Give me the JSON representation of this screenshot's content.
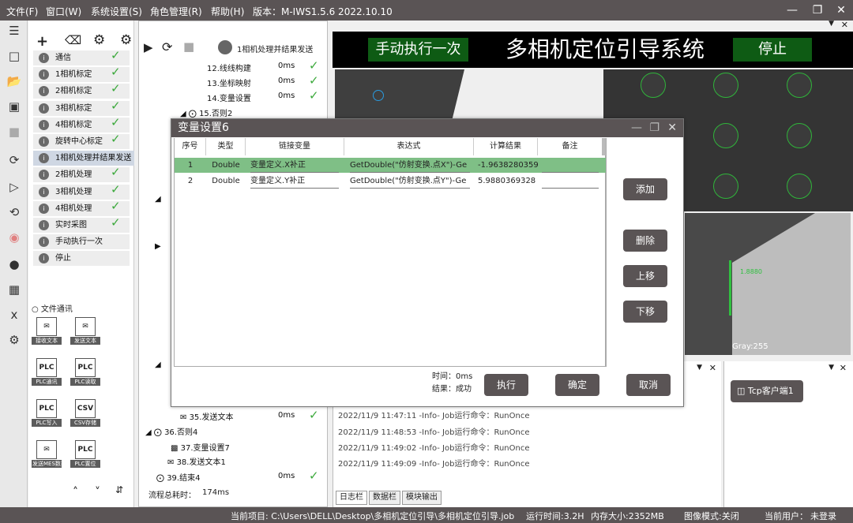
{
  "menu": {
    "file": "文件(F)",
    "window": "窗口(W)",
    "settings": "系统设置(S)",
    "role": "角色管理(R)",
    "help": "帮助(H)",
    "version": "版本：M-IWS1.5.6 2022.10.10"
  },
  "flows": [
    "通信",
    "1相机标定",
    "2相机标定",
    "3相机标定",
    "4相机标定",
    "旋转中心标定",
    "1相机处理并结果发送",
    "2相机处理",
    "3相机处理",
    "4相机处理",
    "实时采图",
    "手动执行一次",
    "停止"
  ],
  "comm_section": "文件通讯",
  "comm_tiles": [
    "接收文本",
    "发送文本",
    "PLC通讯",
    "PLC读取",
    "PLC写入",
    "CSV存储",
    "发送MES数据",
    "PLC置位"
  ],
  "proc": {
    "title": "1相机处理并结果发送",
    "total_label": "流程总耗时：",
    "total_value": "174ms"
  },
  "tree": {
    "n12": "12.线线构建",
    "n13": "13.坐标映射",
    "n14": "14.变量设置",
    "n15": "15.否则2",
    "n35": "35.发送文本",
    "n36": "36.否则4",
    "n37": "37.变量设置7",
    "n38": "38.发送文本1",
    "n39": "39.结束4",
    "ms": "0ms"
  },
  "header": {
    "manual_btn": "手动执行一次",
    "title": "多相机定位引导系统",
    "stop_btn": "停止"
  },
  "image": {
    "gray": "Gray:255",
    "edge": "1.8880"
  },
  "log": {
    "lines": [
      "2022/11/9 11:47:11 -Info- Job运行命令：RunOnce",
      "2022/11/9 11:48:53 -Info- Job运行命令：RunOnce",
      "2022/11/9 11:49:02 -Info- Job运行命令：RunOnce",
      "2022/11/9 11:49:09 -Info- Job运行命令：RunOnce"
    ],
    "tabs": [
      "日志栏",
      "数据栏",
      "模块输出"
    ]
  },
  "tcp": {
    "label": "Tcp客户端1"
  },
  "status": {
    "project": "当前项目:  C:\\Users\\DELL\\Desktop\\多相机定位引导\\多相机定位引导.job",
    "runtime": "运行时间:3.2H",
    "memory": "内存大小:2352MB",
    "imgmode": "图像模式:关闭",
    "user_label": "当前用户：",
    "user": "未登录"
  },
  "dialog": {
    "title": "变量设置6",
    "cols": [
      "序号",
      "类型",
      "链接变量",
      "表达式",
      "计算结果",
      "备注"
    ],
    "rows": [
      {
        "no": "1",
        "type": "Double",
        "link": "变量定义.X补正",
        "expr": "GetDouble(\"仿射变换.点X\")-Ge",
        "result": "-1.9638280359",
        "note": ""
      },
      {
        "no": "2",
        "type": "Double",
        "link": "变量定义.Y补正",
        "expr": "GetDouble(\"仿射变换.点Y\")-Ge",
        "result": "5.9880369328",
        "note": ""
      }
    ],
    "add": "添加",
    "delete": "删除",
    "up": "上移",
    "down": "下移",
    "time_label": "时间：",
    "time_value": "0ms",
    "result_label": "结果：",
    "result_value": "成功",
    "exec": "执行",
    "ok": "确定",
    "cancel": "取消"
  }
}
